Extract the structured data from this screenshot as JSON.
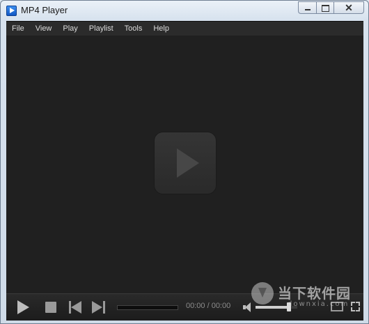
{
  "window": {
    "title": "MP4 Player"
  },
  "menu": {
    "items": [
      {
        "label": "File"
      },
      {
        "label": "View"
      },
      {
        "label": "Play"
      },
      {
        "label": "Playlist"
      },
      {
        "label": "Tools"
      },
      {
        "label": "Help"
      }
    ]
  },
  "controls": {
    "time_display": "00:00 / 00:00",
    "volume_level": 0.8
  },
  "watermark": {
    "title": "当下软件园",
    "subtitle": "downxia.com"
  },
  "colors": {
    "video_bg": "#202020",
    "menubar_bg": "#2b2b2b"
  }
}
